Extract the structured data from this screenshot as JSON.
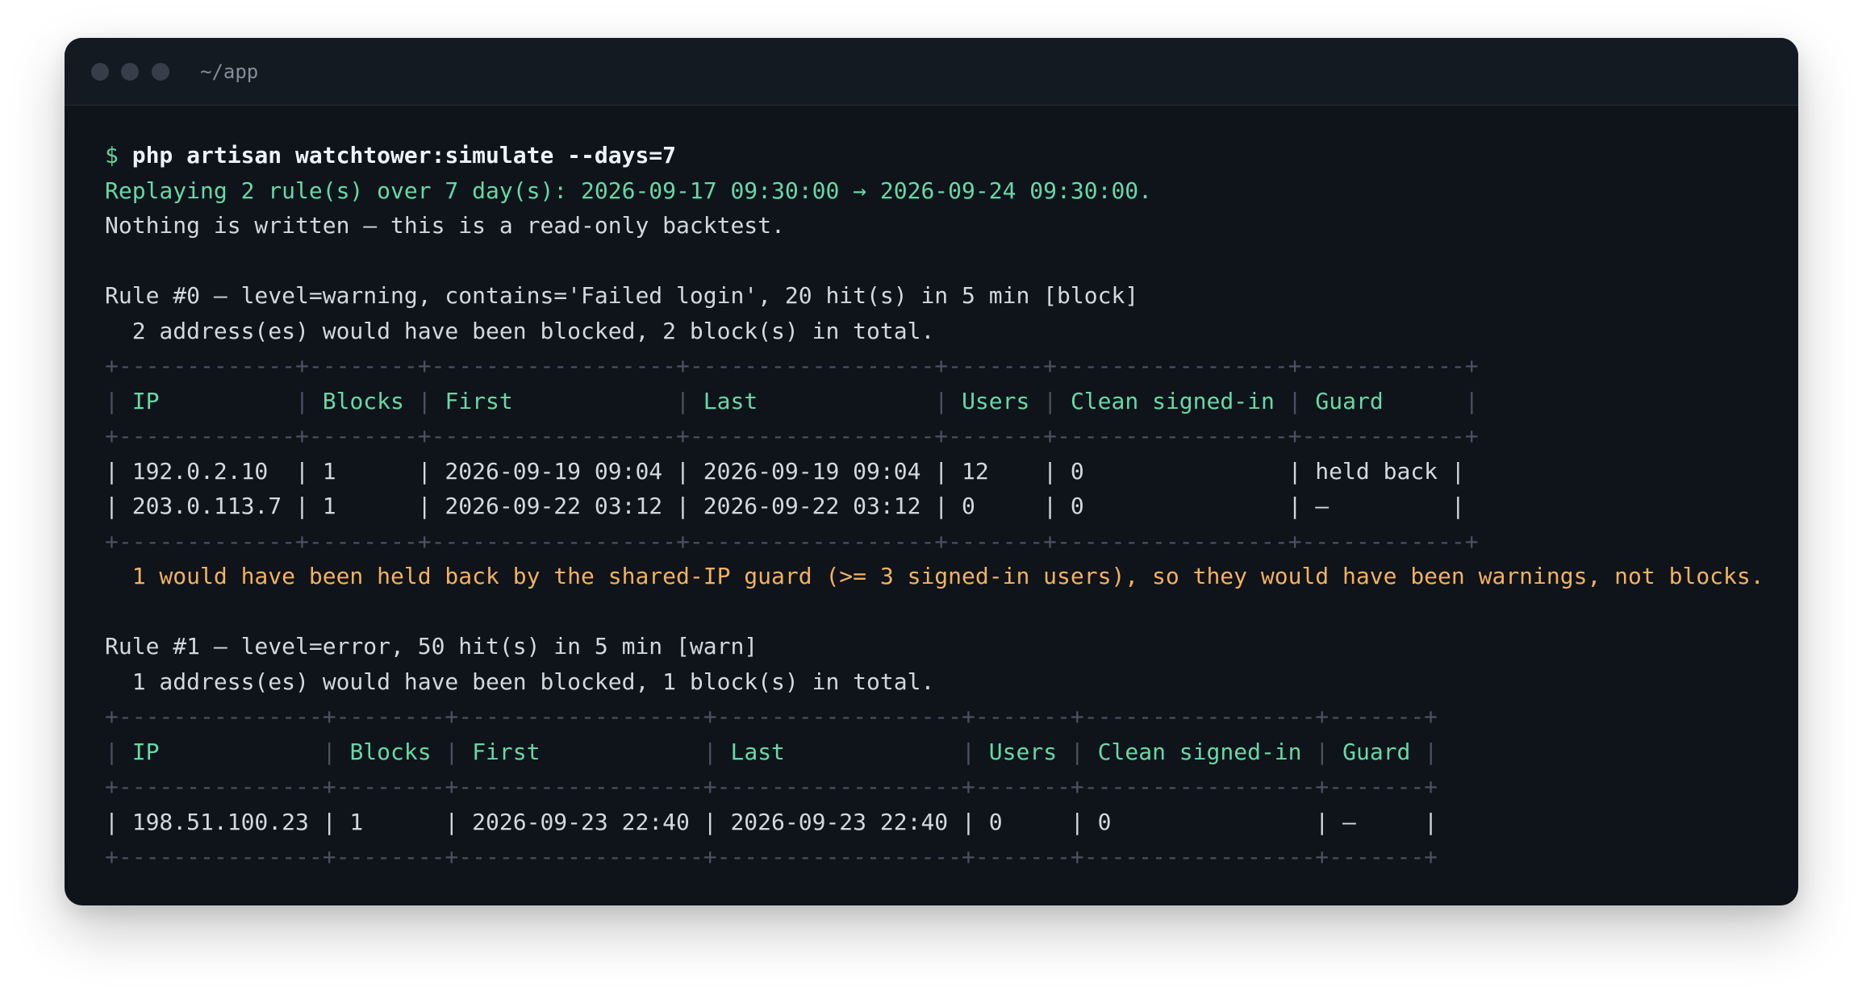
{
  "window": {
    "title": "~/app"
  },
  "command": {
    "prompt": "$",
    "text": "php artisan watchtower:simulate --days=7"
  },
  "output": {
    "replaying": "Replaying 2 rule(s) over 7 day(s): 2026-09-17 09:30:00 → 2026-09-24 09:30:00.",
    "notice": "Nothing is written — this is a read-only backtest."
  },
  "rules": [
    {
      "heading": "Rule #0 — level=warning, contains='Failed login', 20 hit(s) in 5 min [block]",
      "summary": "  2 address(es) would have been blocked, 2 block(s) in total.",
      "table": {
        "border": "+-------------+--------+------------------+------------------+-------+-----------------+------------+",
        "header": {
          "p0": "| ",
          "c0": "IP         ",
          "p1": " | ",
          "c1": "Blocks",
          "p2": " | ",
          "c2": "First           ",
          "p3": " | ",
          "c3": "Last            ",
          "p4": " | ",
          "c4": "Users",
          "p5": " | ",
          "c5": "Clean signed-in",
          "p6": " | ",
          "c6": "Guard     ",
          "p7": " |"
        },
        "rows": [
          "| 192.0.2.10  | 1      | 2026-09-19 09:04 | 2026-09-19 09:04 | 12    | 0               | held back |",
          "| 203.0.113.7 | 1      | 2026-09-22 03:12 | 2026-09-22 03:12 | 0     | 0               | —         |"
        ]
      },
      "warning": "  1 would have been held back by the shared-IP guard (>= 3 signed-in users), so they would have been warnings, not blocks."
    },
    {
      "heading": "Rule #1 — level=error, 50 hit(s) in 5 min [warn]",
      "summary": "  1 address(es) would have been blocked, 1 block(s) in total.",
      "table": {
        "border": "+---------------+--------+------------------+------------------+-------+-----------------+-------+",
        "header": {
          "p0": "| ",
          "c0": "IP           ",
          "p1": " | ",
          "c1": "Blocks",
          "p2": " | ",
          "c2": "First           ",
          "p3": " | ",
          "c3": "Last            ",
          "p4": " | ",
          "c4": "Users",
          "p5": " | ",
          "c5": "Clean signed-in",
          "p6": " | ",
          "c6": "Guard",
          "p7": " |"
        },
        "rows": [
          "| 198.51.100.23 | 1      | 2026-09-23 22:40 | 2026-09-23 22:40 | 0     | 0               | —     |"
        ]
      }
    }
  ],
  "colors": {
    "background": "#0f131a",
    "titlebar": "#141a22",
    "prompt": "#5ed6a0",
    "success": "#66d9a6",
    "warning": "#f2b25e",
    "text": "#d3d8e0",
    "border": "#4a5260"
  }
}
